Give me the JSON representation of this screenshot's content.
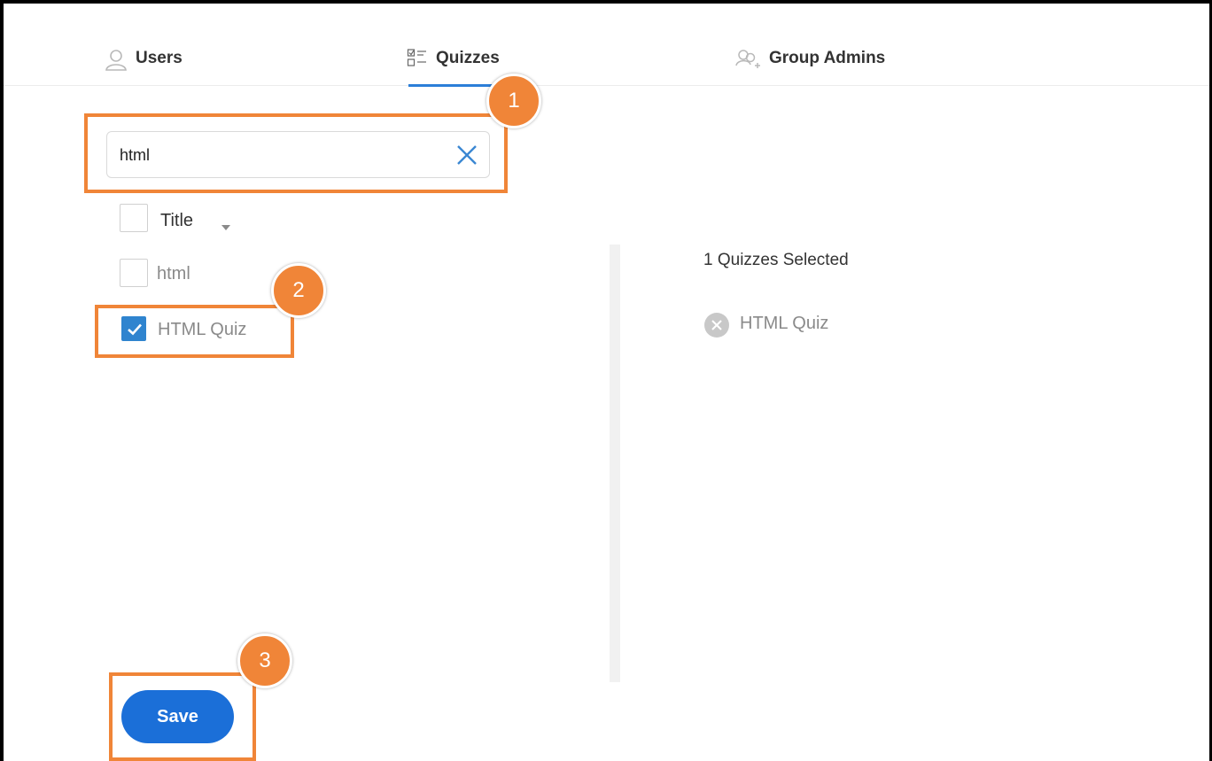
{
  "tabs": [
    {
      "label": "Users",
      "icon": "user-icon",
      "active": false
    },
    {
      "label": "Quizzes",
      "icon": "checklist-icon",
      "active": true
    },
    {
      "label": "Group Admins",
      "icon": "group-admin-icon",
      "active": false
    }
  ],
  "search": {
    "value": "html",
    "placeholder": ""
  },
  "list": {
    "header_label": "Title",
    "items": [
      {
        "label": "html",
        "checked": false
      },
      {
        "label": "HTML Quiz",
        "checked": true
      }
    ]
  },
  "selected": {
    "count_text": "1 Quizzes Selected",
    "items": [
      {
        "label": "HTML Quiz"
      }
    ]
  },
  "save_label": "Save",
  "annotations": [
    "1",
    "2",
    "3"
  ],
  "colors": {
    "accent": "#2c7fd8",
    "button": "#1b6fd8",
    "highlight": "#f08538",
    "checkbox": "#2f84cf"
  }
}
